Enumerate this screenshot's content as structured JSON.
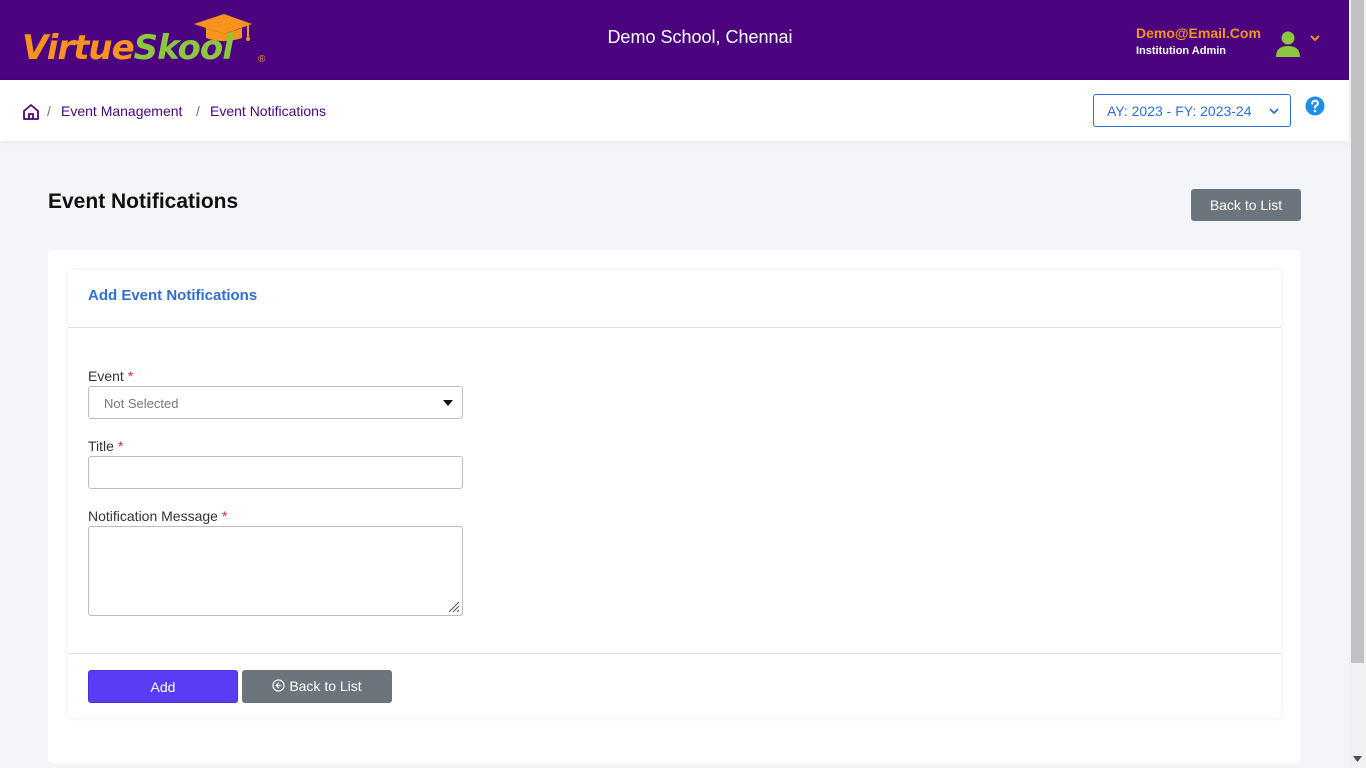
{
  "header": {
    "logo_part1": "Virtue",
    "logo_part2": "Skool",
    "logo_reg": "®",
    "school_name": "Demo School, Chennai",
    "user_email": "Demo@Email.Com",
    "user_role": "Institution Admin"
  },
  "breadcrumb": {
    "sep1": "/",
    "item1": "Event Management",
    "sep2": "/",
    "item2": "Event Notifications"
  },
  "year_select": {
    "value": "AY: 2023 - FY: 2023-24"
  },
  "page": {
    "title": "Event Notifications",
    "back_button": "Back to List"
  },
  "form": {
    "card_title": "Add Event Notifications",
    "event_label": "Event",
    "event_value": "Not Selected",
    "title_label": "Title",
    "title_value": "",
    "message_label": "Notification Message",
    "message_value": "",
    "required_mark": "*",
    "add_button": "Add",
    "back_button": "Back to List"
  },
  "colors": {
    "header_bg": "#4b0380",
    "accent_orange": "#f7941d",
    "accent_green": "#8dc63f",
    "link_blue": "#2f6fd0",
    "primary_button": "#5b3cf5",
    "secondary_button": "#6c757d"
  },
  "icons": {
    "home": "home-icon",
    "help": "question-circle-icon",
    "user": "user-avatar-icon",
    "chevron": "chevron-down-icon",
    "back": "arrow-left-circle-icon"
  }
}
